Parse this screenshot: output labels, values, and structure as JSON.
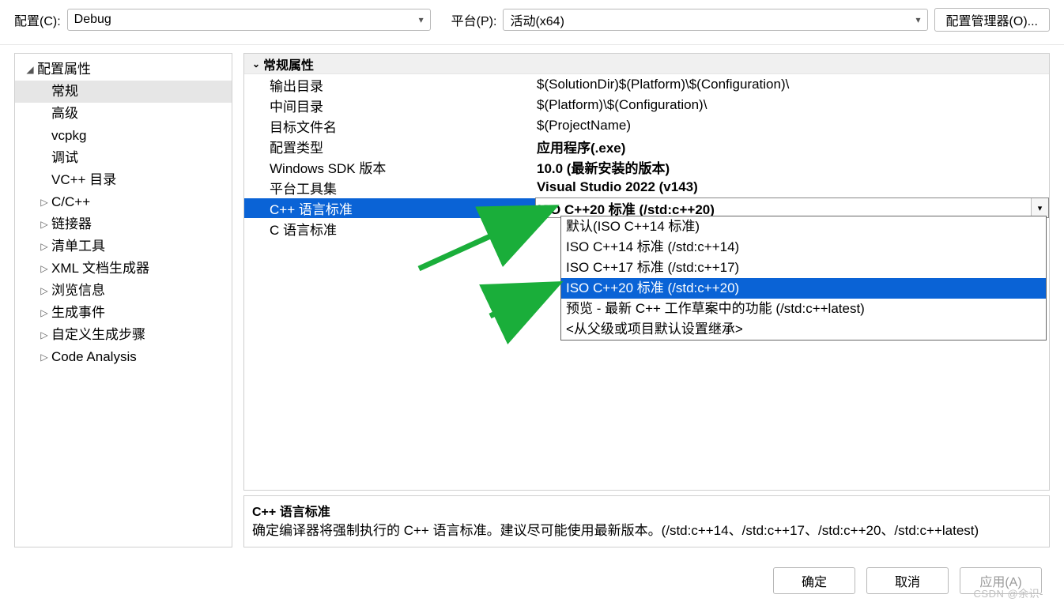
{
  "toolbar": {
    "config_label": "配置(C):",
    "config_value": "Debug",
    "platform_label": "平台(P):",
    "platform_value": "活动(x64)",
    "manager_btn": "配置管理器(O)..."
  },
  "sidebar": {
    "root_label": "配置属性",
    "items": [
      {
        "label": "常规",
        "selected": true,
        "expandable": false
      },
      {
        "label": "高级",
        "expandable": false
      },
      {
        "label": "vcpkg",
        "expandable": false
      },
      {
        "label": "调试",
        "expandable": false
      },
      {
        "label": "VC++ 目录",
        "expandable": false
      },
      {
        "label": "C/C++",
        "expandable": true
      },
      {
        "label": "链接器",
        "expandable": true
      },
      {
        "label": "清单工具",
        "expandable": true
      },
      {
        "label": "XML 文档生成器",
        "expandable": true
      },
      {
        "label": "浏览信息",
        "expandable": true
      },
      {
        "label": "生成事件",
        "expandable": true
      },
      {
        "label": "自定义生成步骤",
        "expandable": true
      },
      {
        "label": "Code Analysis",
        "expandable": true
      }
    ]
  },
  "propgrid": {
    "header": "常规属性",
    "rows": [
      {
        "k": "输出目录",
        "v": "$(SolutionDir)$(Platform)\\$(Configuration)\\"
      },
      {
        "k": "中间目录",
        "v": "$(Platform)\\$(Configuration)\\"
      },
      {
        "k": "目标文件名",
        "v": "$(ProjectName)"
      },
      {
        "k": "配置类型",
        "v": "应用程序(.exe)",
        "bold": true
      },
      {
        "k": "Windows SDK 版本",
        "v": "10.0 (最新安装的版本)",
        "bold": true
      },
      {
        "k": "平台工具集",
        "v": "Visual Studio 2022 (v143)",
        "bold": true
      },
      {
        "k": "C++ 语言标准",
        "v": "ISO C++20 标准 (/std:c++20)",
        "bold": true,
        "selected": true
      },
      {
        "k": "C 语言标准",
        "v": ""
      }
    ],
    "dropdown": [
      {
        "label": "默认(ISO C++14 标准)"
      },
      {
        "label": "ISO C++14 标准 (/std:c++14)"
      },
      {
        "label": "ISO C++17 标准 (/std:c++17)"
      },
      {
        "label": "ISO C++20 标准 (/std:c++20)",
        "selected": true
      },
      {
        "label": "预览 - 最新 C++ 工作草案中的功能 (/std:c++latest)"
      },
      {
        "label": "<从父级或项目默认设置继承>"
      }
    ]
  },
  "description": {
    "title": "C++ 语言标准",
    "body": "确定编译器将强制执行的 C++ 语言标准。建议尽可能使用最新版本。(/std:c++14、/std:c++17、/std:c++20、/std:c++latest)"
  },
  "buttons": {
    "ok": "确定",
    "cancel": "取消",
    "apply": "应用(A)"
  },
  "watermark": "CSDN @余识-",
  "colors": {
    "selection_bg": "#0a63d6",
    "arrow": "#1aae3a"
  }
}
